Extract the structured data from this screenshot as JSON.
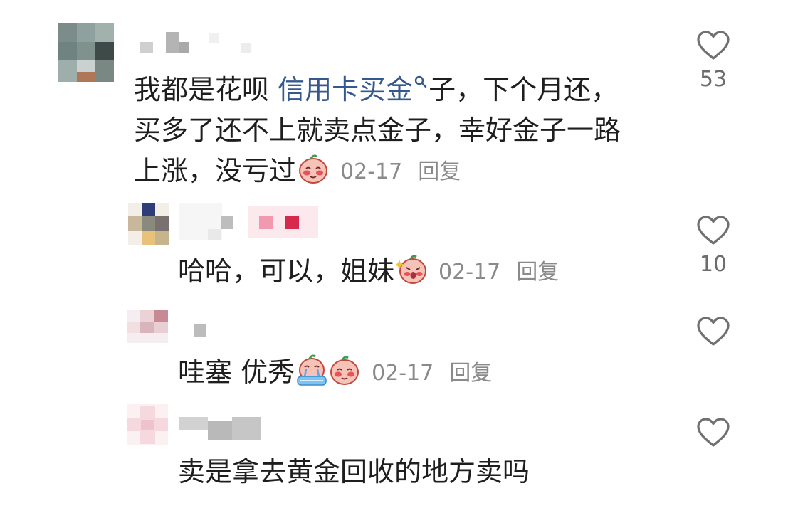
{
  "comments": [
    {
      "text_before_link": "我都是花呗",
      "link_text": "信用卡买金",
      "text_after_link": "子，下个月还，买多了还不上就卖点金子，幸好金子一路上涨，没亏过",
      "emoji": "blushing-face-emoji",
      "date": "02-17",
      "reply_label": "回复",
      "likes": "53"
    },
    {
      "text": "哈哈，可以，姐妹",
      "emoji": "sparkle-laugh-emoji",
      "date": "02-17",
      "reply_label": "回复",
      "likes": "10"
    },
    {
      "text": "哇塞 优秀",
      "emojis": [
        "crying-bath-emoji",
        "blushing-face-emoji"
      ],
      "date": "02-17",
      "reply_label": "回复"
    },
    {
      "text": "卖是拿去黄金回收的地方卖吗"
    }
  ],
  "colors": {
    "link": "#35598f",
    "meta": "#8a8a8a",
    "text": "#1e1e1e"
  }
}
